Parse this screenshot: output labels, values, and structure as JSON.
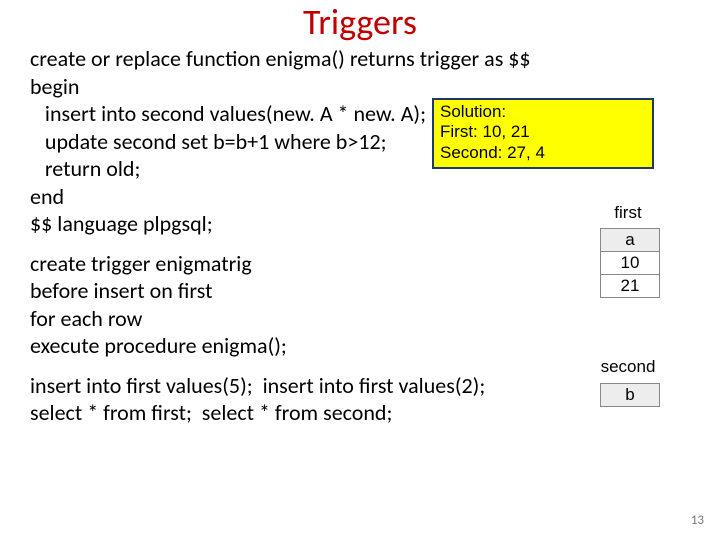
{
  "title": "Triggers",
  "code": {
    "l1": "create or replace function enigma() returns trigger as $$",
    "l2": "begin",
    "l3": "   insert into second values(new. A * new. A);",
    "l4": "   update second set b=b+1 where b>12;",
    "l5": "   return old;",
    "l6": "end",
    "l7": "$$ language plpgsql;",
    "l8": "create trigger enigmatrig",
    "l9": "before insert on first",
    "l10": "for each row",
    "l11": "execute procedure enigma();",
    "l12": "insert into first values(5);  insert into first values(2);",
    "l13": "select * from first;  select * from second;"
  },
  "solution": {
    "heading": "Solution:",
    "line1": "First: 10, 21",
    "line2": "Second: 27, 4"
  },
  "tables": {
    "first_label": "first",
    "first_header": "a",
    "first_row1": "10",
    "first_row2": "21",
    "second_label": "second",
    "second_header": "b"
  },
  "page_number": "13"
}
